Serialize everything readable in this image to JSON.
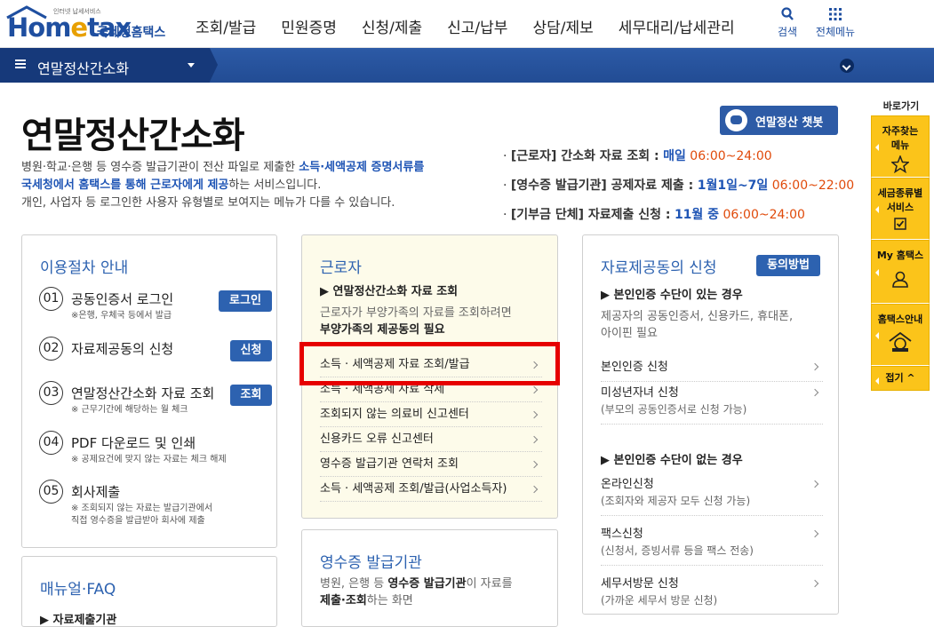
{
  "header": {
    "logo_text_hom": "Hom",
    "logo_text_e": "e",
    "logo_text_tax": "tax",
    "logo_tagline": "인터넷 납세서비스",
    "logo_sub": "국세청홈택스",
    "nav": [
      "조회/발급",
      "민원증명",
      "신청/제출",
      "신고/납부",
      "상담/제보",
      "세무대리/납세관리"
    ],
    "search_label": "검색",
    "allmenu_label": "전체메뉴"
  },
  "bluebar": {
    "title": "연말정산간소화"
  },
  "page": {
    "title": "연말정산간소화",
    "desc_1a": "병원·학교·은행 등 영수증 발급기관이 전산 파일로 제출한 ",
    "desc_1b": "소득·세액공제 증명서류를",
    "desc_2a": "국세청에서 홈택스를 통해 근로자에게 제공",
    "desc_2b": "하는 서비스입니다.",
    "desc_3": "개인, 사업자 등 로그인한 사용자 유형별로 보여지는 메뉴가 다를 수 있습니다.",
    "chatbot_label": "연말정산 챗봇"
  },
  "schedule": [
    {
      "bullet": "·",
      "label": "[근로자] 간소화 자료 조회 :",
      "period": "매일",
      "time": "06:00~24:00"
    },
    {
      "bullet": "·",
      "label": "[영수증 발급기관] 공제자료 제출 :",
      "period": "1월1일~7일",
      "time": "06:00~22:00"
    },
    {
      "bullet": "·",
      "label": "[기부금 단체] 자료제출 신청 :",
      "period": "11월 중",
      "time": "06:00~24:00"
    }
  ],
  "procedure": {
    "title": "이용절차 안내",
    "steps": [
      {
        "num": "01",
        "label": "공동인증서 로그인",
        "note": "※은행, 우체국 등에서 발급",
        "button": "로그인"
      },
      {
        "num": "02",
        "label": "자료제공동의 신청",
        "note": "",
        "button": "신청"
      },
      {
        "num": "03",
        "label": "연말정산간소화 자료 조회",
        "note": "※ 근무기간에 해당하는 월 체크",
        "button": "조회"
      },
      {
        "num": "04",
        "label": "PDF 다운로드 및 인쇄",
        "note": "※ 공제요건에 맞지 않는 자료는 체크 해제",
        "button": ""
      },
      {
        "num": "05",
        "label": "회사제출",
        "note": "※ 조회되지 않는 자료는 발급기관에서",
        "note2": "직접 영수증을 발급받아 회사에 제출",
        "button": ""
      }
    ]
  },
  "manual": {
    "title": "매뉴얼·FAQ",
    "first_item": "▶ 자료제출기관"
  },
  "worker": {
    "title": "근로자",
    "section": "▶ 연말정산간소화 자료 조회",
    "desc_a": "근로자가 부양가족의 자료를 조회하려면",
    "desc_b": "부양가족의 제공동의 필요",
    "links": [
      "소득 · 세액공제 자료 조회/발급",
      "소득 · 세액공제 자료 삭제",
      "조회되지 않는 의료비 신고센터",
      "신용카드 오류 신고센터",
      "영수증 발급기관 연락처 조회",
      "소득 · 세액공제 조회/발급(사업소득자)"
    ]
  },
  "issuer": {
    "title": "영수증 발급기관",
    "desc_a": "병원, 은행 등 ",
    "desc_b": "영수증 발급기관",
    "desc_c": "이 자료를",
    "desc_d": "제출·조회",
    "desc_e": "하는 화면"
  },
  "consent": {
    "title": "자료제공동의 신청",
    "button": "동의방법",
    "sec1": "▶ 본인인증 수단이 있는 경우",
    "sec1_desc_a": "제공자의 공동인증서, 신용카드, 휴대폰,",
    "sec1_desc_b": "아이핀 필요",
    "links1": [
      {
        "label": "본인인증 신청",
        "sub": ""
      },
      {
        "label": "미성년자녀 신청",
        "sub": "(부모의 공동인증서로 신청 가능)"
      }
    ],
    "sec2": "▶ 본인인증 수단이 없는 경우",
    "links2": [
      {
        "label": "온라인신청",
        "sub": "(조회자와 제공자 모두 신청 가능)"
      },
      {
        "label": "팩스신청",
        "sub": "(신청서, 증빙서류 등을 팩스 전송)"
      },
      {
        "label": "세무서방문 신청",
        "sub": "(가까운 세무서 방문 신청)"
      }
    ]
  },
  "quick": {
    "title": "바로가기",
    "items": [
      {
        "label_a": "자주찾는",
        "label_b": "메뉴",
        "icon": "star-icon"
      },
      {
        "label_a": "세금종류별",
        "label_b": "서비스",
        "icon": "checkbox-icon"
      },
      {
        "label_a": "My 홈택스",
        "label_b": "",
        "icon": "user-icon"
      },
      {
        "label_a": "홈택스안내",
        "label_b": "",
        "icon": "info-icon"
      }
    ],
    "collapse": "접기 ^"
  },
  "colors": {
    "brand_blue": "#1f4fa0",
    "bar_blue": "#2c5aa6",
    "accent_red": "#e04a0a",
    "quick_yellow": "#fbc41a"
  }
}
